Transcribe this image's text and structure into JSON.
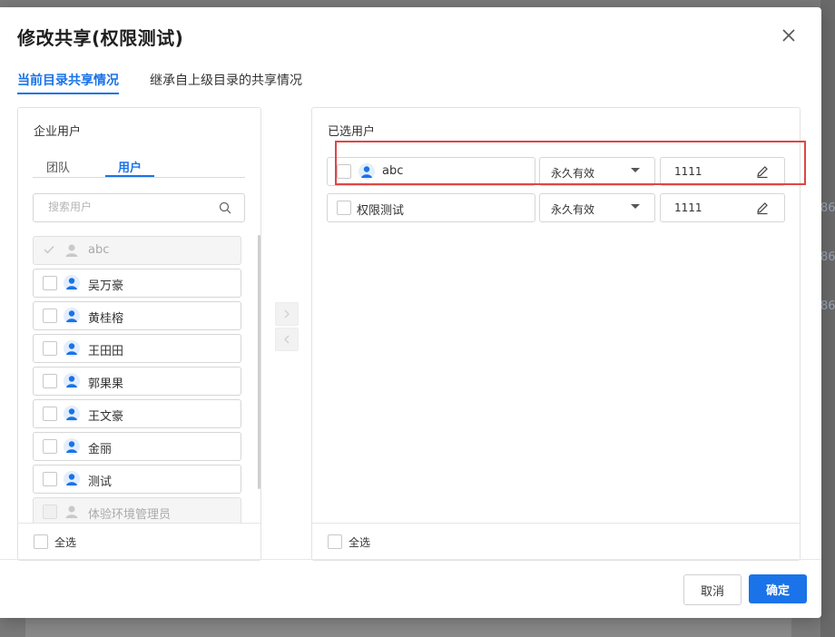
{
  "modal": {
    "title": "修改共享(权限测试)",
    "tabs": [
      {
        "label": "当前目录共享情况",
        "active": true
      },
      {
        "label": "继承自上级目录的共享情况",
        "active": false
      }
    ]
  },
  "left_panel": {
    "title": "企业用户",
    "subtabs": [
      {
        "label": "团队",
        "active": false
      },
      {
        "label": "用户",
        "active": true
      }
    ],
    "search_placeholder": "搜索用户",
    "users": [
      {
        "name": "abc",
        "checked": true,
        "disabled": true
      },
      {
        "name": "吴万豪",
        "checked": false,
        "disabled": false
      },
      {
        "name": "黄桂榕",
        "checked": false,
        "disabled": false
      },
      {
        "name": "王田田",
        "checked": false,
        "disabled": false
      },
      {
        "name": "郭果果",
        "checked": false,
        "disabled": false
      },
      {
        "name": "王文豪",
        "checked": false,
        "disabled": false
      },
      {
        "name": "金丽",
        "checked": false,
        "disabled": false
      },
      {
        "name": "测试",
        "checked": false,
        "disabled": false
      },
      {
        "name": "体验环境管理员",
        "checked": false,
        "disabled": true
      }
    ],
    "select_all_label": "全选"
  },
  "right_panel": {
    "title": "已选用户",
    "rows": [
      {
        "name": "abc",
        "has_avatar": true,
        "validity": "永久有效",
        "password": "1111"
      },
      {
        "name": "权限测试",
        "has_avatar": false,
        "validity": "永久有效",
        "password": "1111"
      }
    ],
    "select_all_label": "全选"
  },
  "footer": {
    "cancel_label": "取消",
    "ok_label": "确定"
  },
  "background": {
    "cells": [
      "86",
      "86",
      "86"
    ]
  },
  "colors": {
    "accent": "#1a73e8",
    "highlight": "#e04545"
  }
}
